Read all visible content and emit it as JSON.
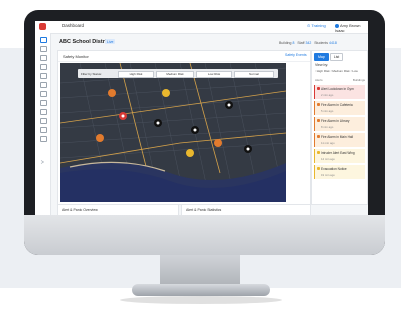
{
  "header": {
    "app_title": "Dashboard",
    "training_label": "Training",
    "user_label": "Amy Brown Isaac"
  },
  "page": {
    "title": "ABC School District",
    "badge": "Live",
    "stats": [
      {
        "label": "Building",
        "value": "8"
      },
      {
        "label": "Staff",
        "value": "342"
      },
      {
        "label": "Students",
        "value": "4418"
      }
    ]
  },
  "map_card": {
    "title": "Safety Monitor",
    "events_label": "Safety Events",
    "filter": {
      "label": "Filter by Status:",
      "options": [
        "High Risk",
        "Medium Risk",
        "Low Risk",
        "Normal"
      ]
    }
  },
  "right_panel": {
    "tabs": [
      "Map",
      "List"
    ],
    "view_by": "View by:",
    "radios": [
      "High Risk",
      "Medium Risk",
      "Low"
    ],
    "col_left": "Alerts",
    "col_right": "Buildings",
    "alerts": [
      {
        "title": "Alert Lockdown in Gym",
        "sub": "2 min ago",
        "color": "#d93a35",
        "bg": "#fbe3e2"
      },
      {
        "title": "Fire Alarm in Cafeteria",
        "sub": "5 min ago",
        "color": "#e27b2e",
        "bg": "#fdeedd"
      },
      {
        "title": "Fire Alarm in Library",
        "sub": "8 min ago",
        "color": "#e27b2e",
        "bg": "#fdeedd"
      },
      {
        "title": "Fire Alarm in Main Hall",
        "sub": "11 min ago",
        "color": "#e27b2e",
        "bg": "#fdeedd"
      },
      {
        "title": "Intruder Alert East Wing",
        "sub": "14 min ago",
        "color": "#e9b72e",
        "bg": "#fdf6df"
      },
      {
        "title": "Evacuation Notice",
        "sub": "19 min ago",
        "color": "#e9b72e",
        "bg": "#fdf6df"
      }
    ]
  },
  "bottom": {
    "left_title": "Alert & Panic Overview",
    "right_title": "Alert & Panic Statistics"
  },
  "colors": {
    "accent": "#1f7ae0",
    "danger": "#d93a35",
    "warning": "#e27b2e",
    "caution": "#e9b72e",
    "map_land": "#343a44",
    "map_water": "#27366b"
  }
}
